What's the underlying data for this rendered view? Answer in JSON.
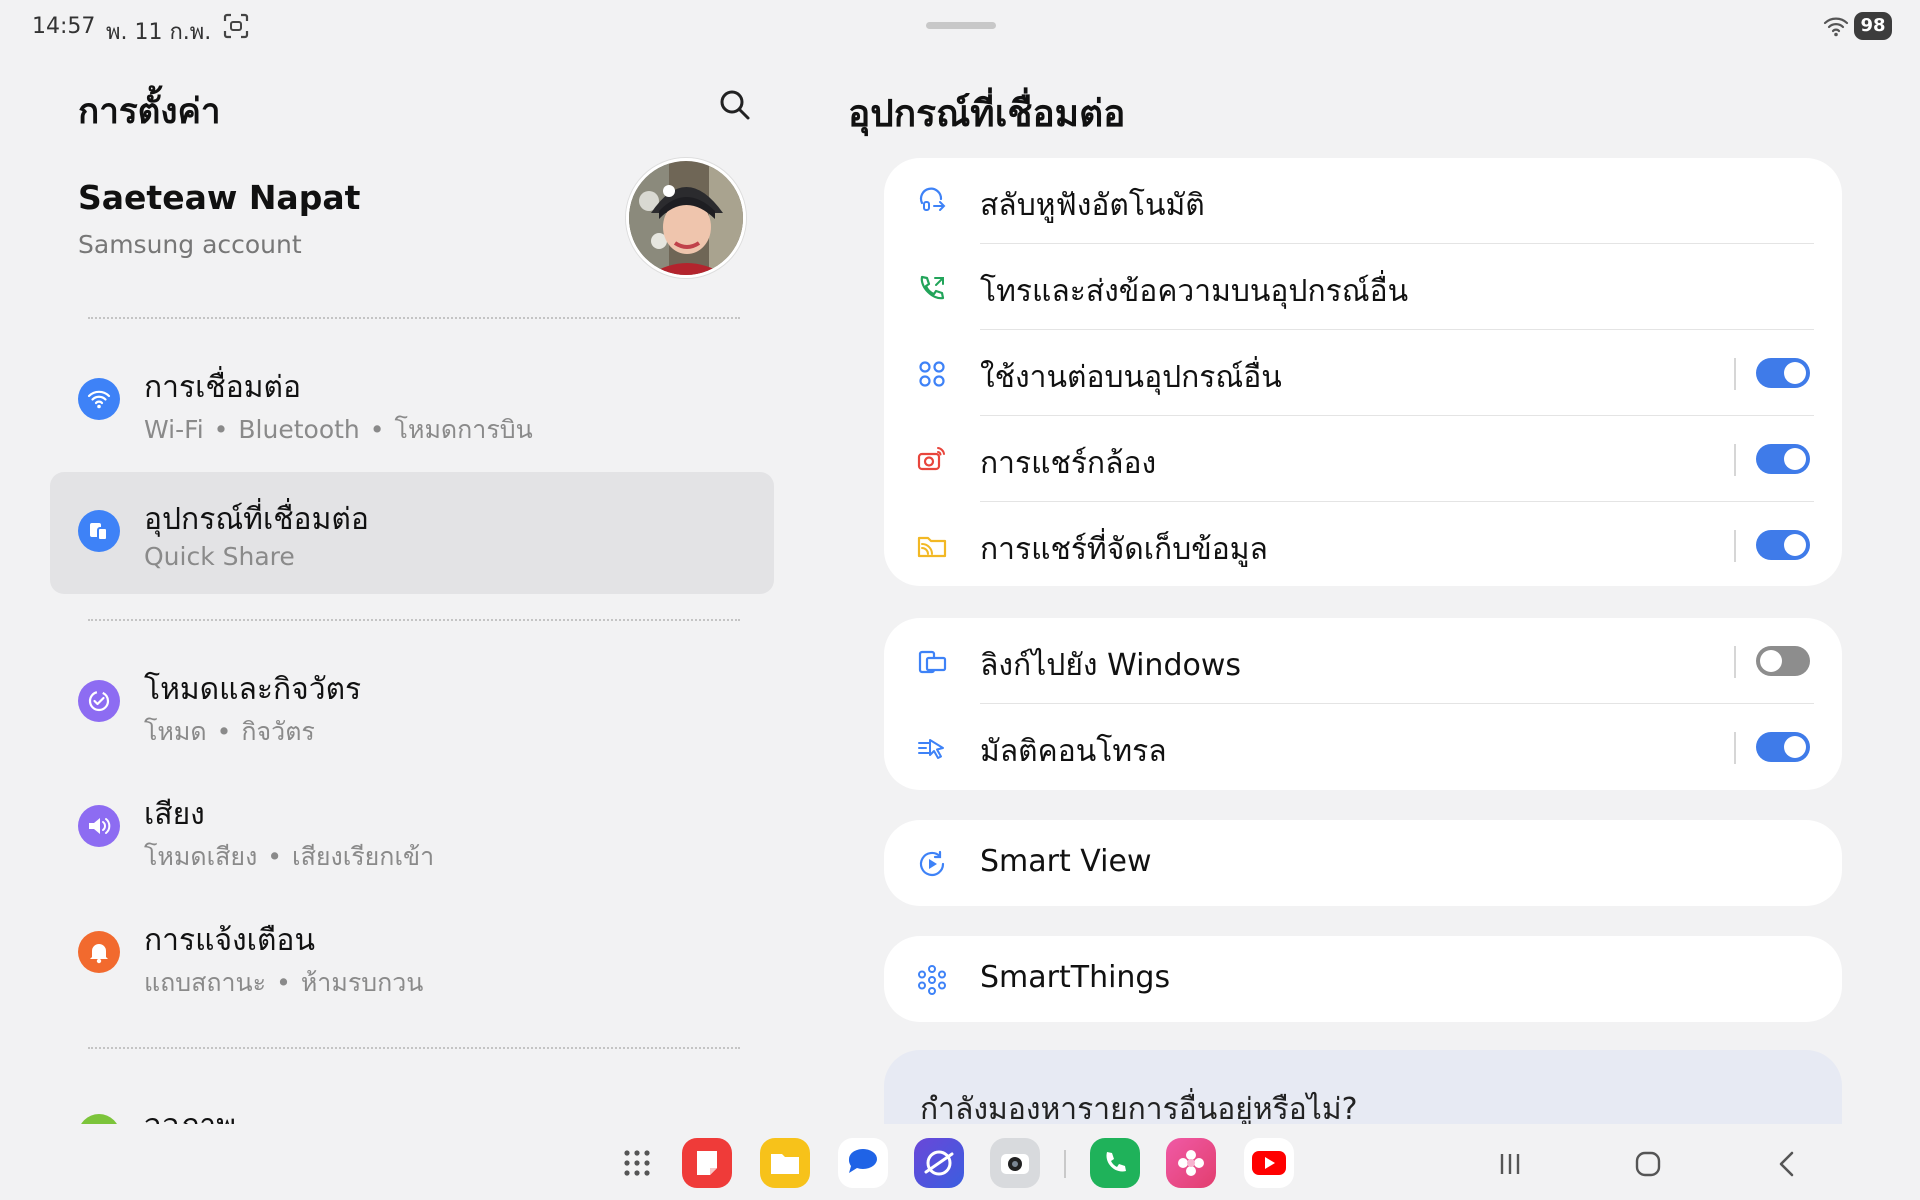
{
  "status_bar": {
    "time": "14:57",
    "date": "พ. 11 ก.พ.",
    "battery": "98"
  },
  "left": {
    "title": "การตั้งค่า",
    "profile": {
      "name": "Saeteaw Napat",
      "sub": "Samsung account"
    },
    "items": [
      {
        "title": "การเชื่อมต่อ",
        "sub": [
          "Wi-Fi",
          "Bluetooth",
          "โหมดการบิน"
        ],
        "icon": "wifi-icon",
        "color": "#3e82f7"
      },
      {
        "title": "อุปกรณ์ที่เชื่อมต่อ",
        "sub": [
          "Quick Share"
        ],
        "icon": "connected-devices-icon",
        "color": "#3e82f7",
        "selected": true
      },
      {
        "title": "โหมดและกิจวัตร",
        "sub": [
          "โหมด",
          "กิจวัตร"
        ],
        "icon": "modes-icon",
        "color": "#8d6cf2"
      },
      {
        "title": "เสียง",
        "sub": [
          "โหมดเสียง",
          "เสียงเรียกเข้า"
        ],
        "icon": "volume-icon",
        "color": "#8d6cf2"
      },
      {
        "title": "การแจ้งเตือน",
        "sub": [
          "แถบสถานะ",
          "ห้ามรบกวน"
        ],
        "icon": "bell-icon",
        "color": "#f26a2e"
      },
      {
        "title": "จอภาพ",
        "sub": [],
        "icon": "display-icon",
        "color": "#7cc43a"
      }
    ]
  },
  "right": {
    "title": "อุปกรณ์ที่เชื่อมต่อ",
    "group1": [
      {
        "label": "สลับหูฟังอัตโนมัติ",
        "icon": "earbuds-switch-icon"
      },
      {
        "label": "โทรและส่งข้อความบนอุปกรณ์อื่น",
        "icon": "call-other-device-icon"
      },
      {
        "label": "ใช้งานต่อบนอุปกรณ์อื่น",
        "icon": "continue-apps-icon",
        "toggle": "on"
      },
      {
        "label": "การแชร์กล้อง",
        "icon": "camera-share-icon",
        "toggle": "on"
      },
      {
        "label": "การแชร์ที่จัดเก็บข้อมูล",
        "icon": "storage-share-icon",
        "toggle": "on"
      }
    ],
    "group2": [
      {
        "label": "ลิงก์ไปยัง Windows",
        "icon": "link-windows-icon",
        "toggle": "off"
      },
      {
        "label": "มัลติคอนโทรล",
        "icon": "multi-control-icon",
        "toggle": "on"
      }
    ],
    "smart_view": "Smart View",
    "smartthings": "SmartThings",
    "hint": "กำลังมองหารายการอื่นอยู่หรือไม่?"
  },
  "colors": {
    "accent": "#3f7be9",
    "background": "#f2f2f3"
  }
}
